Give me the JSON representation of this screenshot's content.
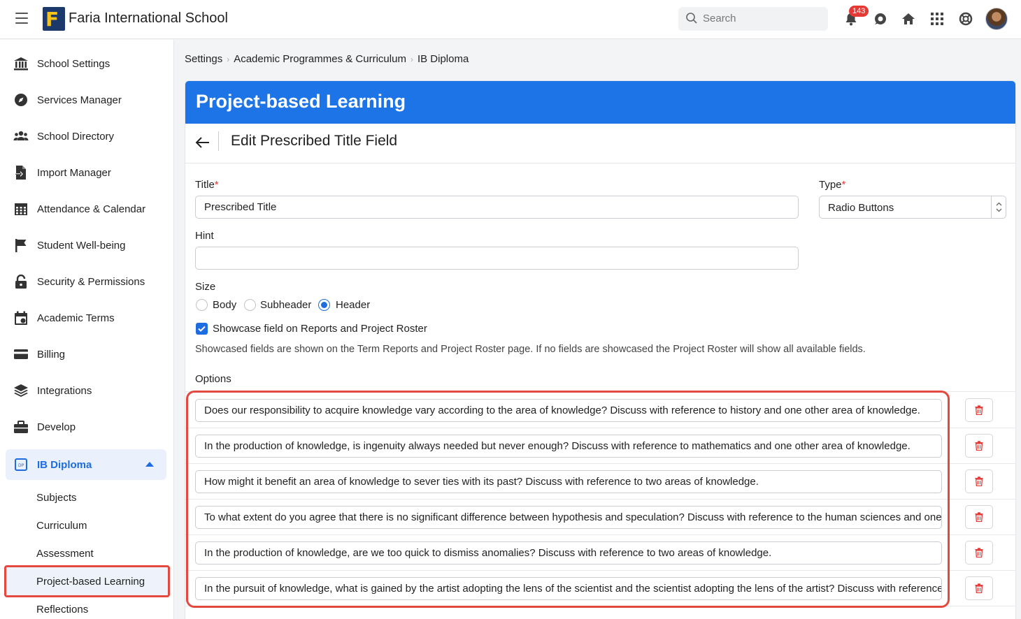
{
  "header": {
    "brand": "Faria International School",
    "search_placeholder": "Search",
    "notification_count": "143"
  },
  "sidebar": {
    "items": [
      {
        "label": "School Settings",
        "icon": "bank-icon"
      },
      {
        "label": "Services Manager",
        "icon": "compass-icon"
      },
      {
        "label": "School Directory",
        "icon": "people-icon"
      },
      {
        "label": "Import Manager",
        "icon": "file-import-icon"
      },
      {
        "label": "Attendance & Calendar",
        "icon": "calendar-grid-icon"
      },
      {
        "label": "Student Well-being",
        "icon": "flag-icon"
      },
      {
        "label": "Security & Permissions",
        "icon": "lock-icon"
      },
      {
        "label": "Academic Terms",
        "icon": "calendar-check-icon"
      },
      {
        "label": "Billing",
        "icon": "credit-card-icon"
      },
      {
        "label": "Integrations",
        "icon": "layers-icon"
      },
      {
        "label": "Develop",
        "icon": "briefcase-icon"
      }
    ],
    "active_section": {
      "label": "IB Diploma",
      "icon": "ib-icon"
    },
    "subitems": [
      "Subjects",
      "Curriculum",
      "Assessment",
      "Project-based Learning",
      "Reflections"
    ]
  },
  "breadcrumb": [
    "Settings",
    "Academic Programmes & Curriculum",
    "IB Diploma"
  ],
  "panel": {
    "title": "Project-based Learning",
    "subtitle": "Edit Prescribed Title Field"
  },
  "form": {
    "title_label": "Title",
    "title_value": "Prescribed Title",
    "type_label": "Type",
    "type_value": "Radio Buttons",
    "hint_label": "Hint",
    "hint_value": "",
    "size_label": "Size",
    "size_options": [
      "Body",
      "Subheader",
      "Header"
    ],
    "size_selected": "Header",
    "showcase_label": "Showcase field on Reports and Project Roster",
    "showcase_checked": true,
    "showcase_help": "Showcased fields are shown on the Term Reports and Project Roster page. If no fields are showcased the Project Roster will show all available fields.",
    "options_label": "Options",
    "options": [
      "Does our responsibility to acquire knowledge vary according to the area of knowledge? Discuss with reference to history and one other area of knowledge.",
      "In the production of knowledge, is ingenuity always needed but never enough? Discuss with reference to mathematics and one other area of knowledge.",
      "How might it benefit an area of knowledge to sever ties with its past? Discuss with reference to two areas of knowledge.",
      "To what extent do you agree that there is no significant difference between hypothesis and speculation? Discuss with reference to the human sciences and one other area of knowledge.",
      "In the production of knowledge, are we too quick to dismiss anomalies? Discuss with reference to two areas of knowledge.",
      "In the pursuit of knowledge, what is gained by the artist adopting the lens of the scientist and the scientist adopting the lens of the artist? Discuss with reference to the arts and the natural sciences."
    ]
  },
  "colors": {
    "accent": "#1d74e6",
    "highlight": "#e4493f",
    "danger": "#e53935"
  }
}
